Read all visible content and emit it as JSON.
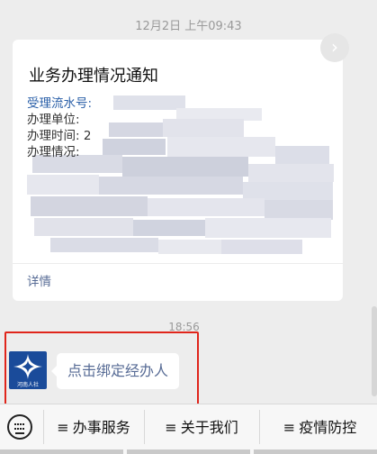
{
  "chat": {
    "timestamp": "12月2日 上午09:43",
    "time2": "18:56"
  },
  "card": {
    "title": "业务办理情况通知",
    "fields": [
      {
        "label": "受理流水号:"
      },
      {
        "label": "办理单位:"
      },
      {
        "label": "办理时间: 2"
      },
      {
        "label": "办理情况:"
      }
    ],
    "details_label": "详情",
    "arrow_glyph": "›"
  },
  "message": {
    "bubble_text": "点击绑定经办人",
    "avatar_caption": "河南人社"
  },
  "menu": {
    "items": [
      {
        "glyph": "≡",
        "label": "办事服务"
      },
      {
        "glyph": "≡",
        "label": "关于我们"
      },
      {
        "glyph": "≡",
        "label": "疫情防控"
      }
    ]
  },
  "colors": {
    "highlight": "#e0251b",
    "link": "#576b95",
    "avatar_bg": "#1a4b9a"
  }
}
